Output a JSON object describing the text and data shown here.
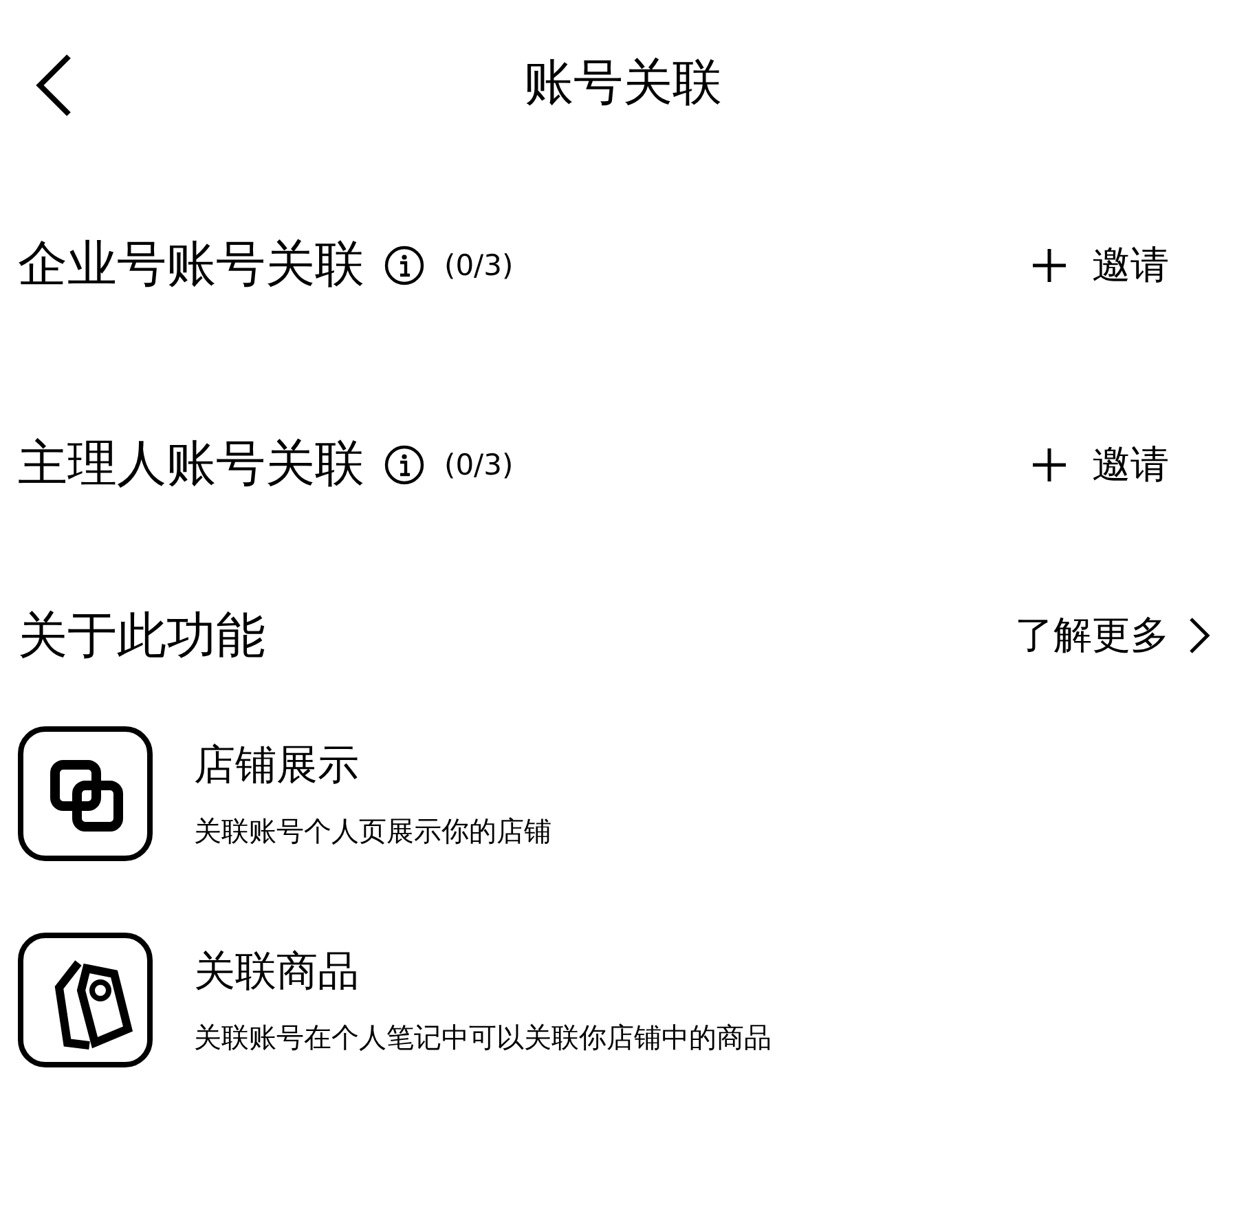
{
  "header": {
    "title": "账号关联"
  },
  "links": [
    {
      "label": "企业号账号关联",
      "count": "(0/3)",
      "action": "邀请"
    },
    {
      "label": "主理人账号关联",
      "count": "(0/3)",
      "action": "邀请"
    }
  ],
  "about": {
    "title": "关于此功能",
    "more": "了解更多"
  },
  "features": [
    {
      "kind": "store",
      "title": "店铺展示",
      "description": "关联账号个人页展示你的店铺"
    },
    {
      "kind": "tag",
      "title": "关联商品",
      "description": "关联账号在个人笔记中可以关联你店铺中的商品"
    }
  ]
}
